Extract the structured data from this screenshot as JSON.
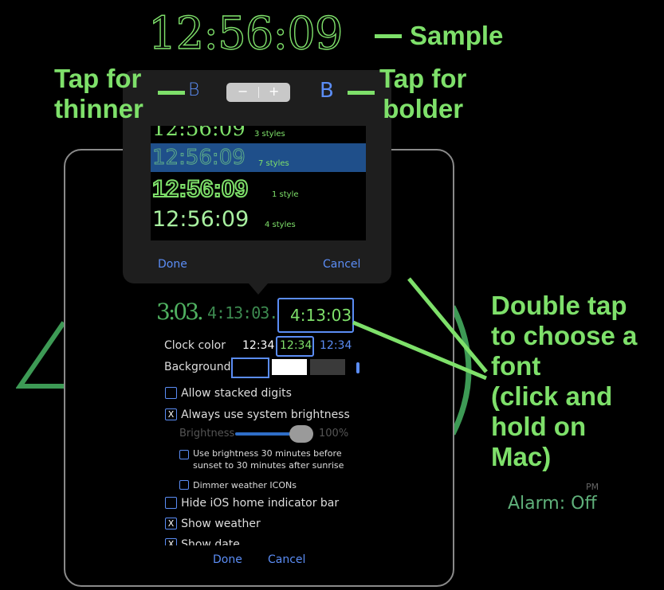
{
  "annotations": {
    "sample_time": "12:56:09",
    "sample": "Sample",
    "tap_thinner_1": "Tap for",
    "tap_thinner_2": "thinner",
    "tap_bolder_1": "Tap for",
    "tap_bolder_2": "bolder",
    "double_tap": [
      "Double tap",
      "to choose a",
      "font",
      "(click and",
      "hold on",
      "Mac)"
    ]
  },
  "background": {
    "digit_right": "3",
    "pm_small": "PM",
    "pm": "PM",
    "alarm": "Alarm: Off"
  },
  "popover": {
    "thin_b": "B",
    "bold_b": "B",
    "stepper_minus": "−",
    "stepper_plus": "+",
    "fonts": [
      {
        "time": "12:56:09",
        "styles": "3 styles"
      },
      {
        "time": "12:56:09",
        "styles": "7 styles"
      },
      {
        "time": "12:56:09",
        "styles": "1 style"
      },
      {
        "time": "12:56:09",
        "styles": "4 styles"
      }
    ],
    "done": "Done",
    "cancel": "Cancel"
  },
  "settings": {
    "clock_previews": [
      "3:03.",
      "4:13:03.",
      "4:13:03"
    ],
    "clock_color_label": "Clock color",
    "clock_color_options": [
      "12:34",
      "12:34",
      "12:34"
    ],
    "background_label": "Background",
    "allow_stacked": "Allow stacked digits",
    "always_system_brightness": "Always use system brightness",
    "brightness_label": "Brightness",
    "brightness_value": "100%",
    "brightness_level": 0.85,
    "use_brightness_1": "Use brightness 30 minutes before",
    "use_brightness_2": "sunset to 30 minutes after sunrise",
    "dimmer_weather": "Dimmer weather ICONs",
    "hide_home": "Hide iOS home indicator bar",
    "show_weather": "Show weather",
    "show_date": "Show date",
    "done": "Done",
    "cancel": "Cancel",
    "check_mark": "X"
  },
  "colors": {
    "accent_green": "#7ee06a",
    "link_blue": "#5b8df5",
    "selected_row": "#1f4f8a"
  }
}
